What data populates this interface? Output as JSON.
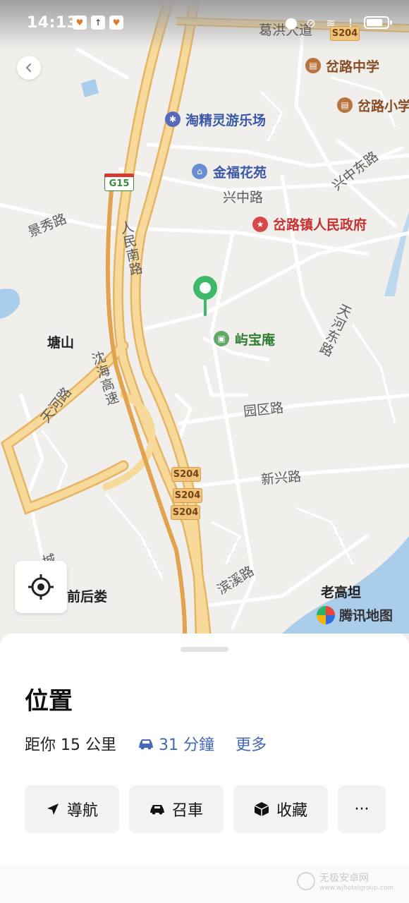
{
  "status_bar": {
    "time": "14:13",
    "left_icons": [
      "app-notification-icon",
      "upload-icon",
      "app-notification-icon"
    ],
    "right_icons": [
      "location-icon",
      "mute-icon",
      "wifi-icon",
      "alert-icon",
      "battery-icon"
    ]
  },
  "map": {
    "road_labels": {
      "gehong": "葛洪大道",
      "xingzhong": "兴中路",
      "xingzhong_east": "兴中东路",
      "jingxiu": "景秀路",
      "renmin_south": "人民南路",
      "tianhe": "天河路",
      "tianhe_east": "天河东路",
      "shenhai": "沈海高速",
      "yuanqu": "园区路",
      "xinxing": "新兴路",
      "binxi": "滨溪路",
      "cheng": "城"
    },
    "shields": {
      "g15": "G15",
      "s204_top": "S204",
      "s204_a": "S204",
      "s204_b": "S204",
      "s204_c": "S204"
    },
    "pois": {
      "school_middle": "岔路中学",
      "school_primary": "岔路小学",
      "amusement": "淘精灵游乐场",
      "residential": "金福花苑",
      "government": "岔路镇人民政府",
      "temple": "屿宝庵"
    },
    "places": {
      "tangshan": "塘山",
      "qianhoulou": "前后娄",
      "laogaotan": "老高坦"
    },
    "brand": "腾讯地图",
    "colors": {
      "highway": "#f1c27a",
      "water": "#a9cdea",
      "pin": "#3fb86b"
    }
  },
  "sheet": {
    "title": "位置",
    "distance": "距你 15 公里",
    "drive_time": "31 分鐘",
    "more": "更多",
    "actions": {
      "navigate": "導航",
      "ride": "召車",
      "favorite": "收藏",
      "more": "···"
    }
  },
  "watermark": {
    "text": "无极安卓网",
    "url": "www.wjhotelgroup.com"
  }
}
